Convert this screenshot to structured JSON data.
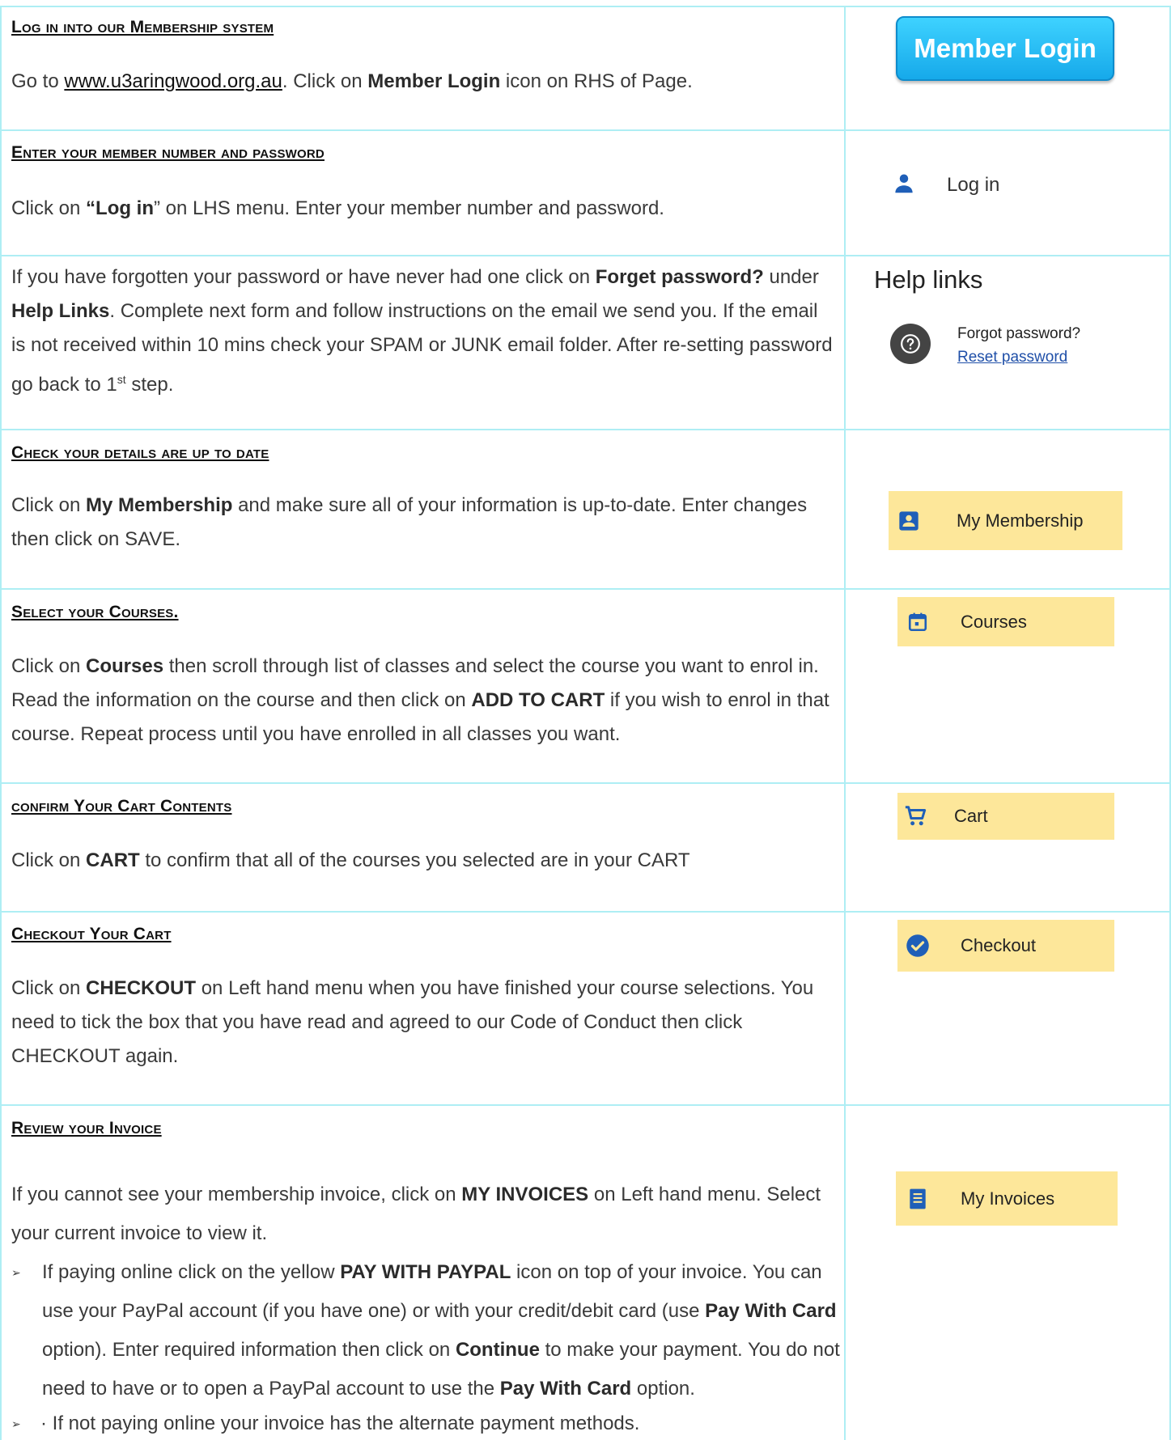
{
  "sections": {
    "login": {
      "heading": "Log in into our Membership system",
      "pre": "Go to ",
      "link": "www.u3aringwood.org.au",
      "mid": ". Click on ",
      "bold": "Member Login",
      "post": " icon on RHS of Page.",
      "button": "Member Login"
    },
    "enter": {
      "heading": "Enter your member number and password",
      "pre": "Click on ",
      "bold": "“Log in",
      "post": "” on LHS menu. Enter your member number and password.",
      "menu_label": "Log in",
      "icon": "person-icon"
    },
    "forgot": {
      "t1": "If you have forgotten your password or have never had one click on ",
      "b1": "Forget password?",
      "t2": " under ",
      "b2": "Help Links",
      "t3": ". Complete next form and follow instructions on the email we send you. If the email is not received within 10 mins check your SPAM or JUNK email folder. After re-setting password go back to 1",
      "sup": "st",
      "t4": " step.",
      "help_title": "Help links",
      "help_q": "Forgot password?",
      "help_link": "Reset password",
      "icon": "help-circle-icon"
    },
    "details": {
      "heading": "Check your details are up to date",
      "pre": "Click on ",
      "bold": "My Membership",
      "post": " and make sure all of your information is up-to-date.  Enter changes then click on SAVE.",
      "menu_label": "My Membership",
      "icon": "id-card-icon"
    },
    "courses": {
      "heading": "Select your Courses.",
      "t1": "Click on ",
      "b1": "Courses",
      "t2": " then scroll through list of classes and select the course you want to enrol in. Read the information on the course and then click on ",
      "b2": "ADD TO CART",
      "t3": " if you wish to enrol in that course. Repeat process until you have enrolled in all classes you want.",
      "menu_label": "Courses",
      "icon": "calendar-icon"
    },
    "cart": {
      "heading": "confirm Your Cart Contents",
      "pre": "Click on ",
      "bold": "CART",
      "post": " to confirm that all of the courses you selected are in your CART",
      "menu_label": "Cart",
      "icon": "cart-icon"
    },
    "checkout": {
      "heading": "Checkout Your Cart",
      "pre": "Click on ",
      "bold": "CHECKOUT",
      "post": " on Left hand menu when you have finished your course selections. You need to tick the box that you have read and agreed to our Code of Conduct then click CHECKOUT again.",
      "menu_label": "Checkout",
      "icon": "check-circle-icon"
    },
    "invoice": {
      "heading": "Review your Invoice",
      "pre": "If you cannot see your membership invoice, click on ",
      "bold": "MY INVOICES",
      "post": " on Left hand menu. Select your current invoice to view it.",
      "bullet1": {
        "t1": "If paying online click on the yellow ",
        "b1": "PAY WITH PAYPAL",
        "t2": " icon on top of your invoice. You can use your PayPal account (if you have one) or with your credit/debit card (use ",
        "b2": "Pay With Card",
        "t3": " option). Enter required information then click on ",
        "b3": "Continue",
        "t4": " to make your payment. You do not need to have or to open a PayPal account to use the ",
        "b4": "Pay With Card",
        "t5": " option."
      },
      "bullet2": "· If not paying online your invoice has the alternate payment methods.",
      "bullet_mark": "➢",
      "menu_label": "My Invoices",
      "icon": "receipt-icon"
    }
  },
  "colors": {
    "grid": "#aeeef4",
    "menu_bg": "#fde79a",
    "icon_blue": "#1f5fb8",
    "login_button": "#1cb3f0"
  }
}
